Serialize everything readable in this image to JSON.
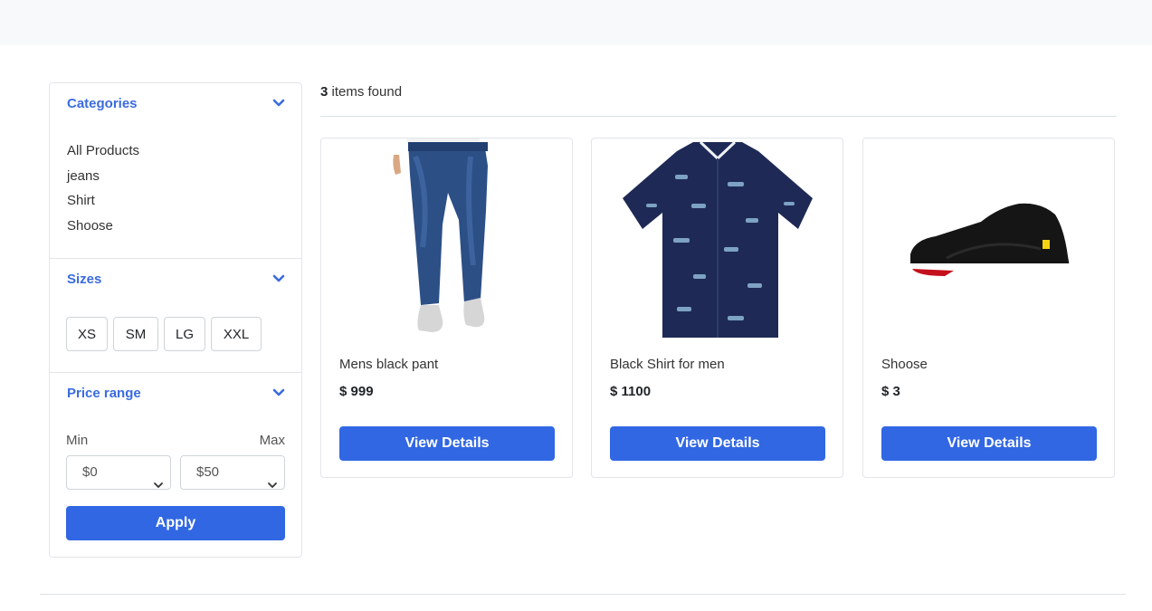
{
  "results": {
    "count": "3",
    "suffix": " items found"
  },
  "filters": {
    "categories": {
      "title": "Categories",
      "items": [
        "All Products",
        "jeans",
        "Shirt",
        "Shoose"
      ]
    },
    "sizes": {
      "title": "Sizes",
      "options": [
        "XS",
        "SM",
        "LG",
        "XXL"
      ]
    },
    "price": {
      "title": "Price range",
      "min_label": "Min",
      "max_label": "Max",
      "min_value": "$0",
      "max_value": "$50",
      "apply_label": "Apply"
    }
  },
  "products": [
    {
      "name": "Mens black pant",
      "price": "$ 999",
      "button": "View Details"
    },
    {
      "name": "Black Shirt for men",
      "price": "$ 1100",
      "button": "View Details"
    },
    {
      "name": "Shoose",
      "price": "$ 3",
      "button": "View Details"
    }
  ],
  "colors": {
    "accent": "#3167e3",
    "heading": "#3a6be0",
    "border": "#e2e5e9"
  }
}
